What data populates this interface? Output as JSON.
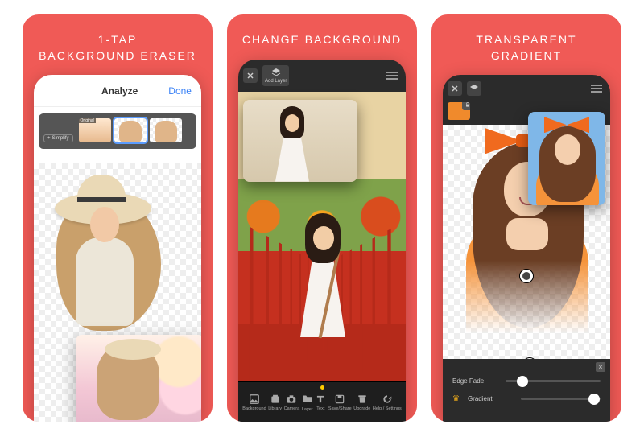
{
  "cards": [
    {
      "title": "1-TAP\nBACKGROUND ERASER"
    },
    {
      "title": "CHANGE BACKGROUND"
    },
    {
      "title": "TRANSPARENT\nGRADIENT"
    }
  ],
  "card1": {
    "header": {
      "title": "Analyze",
      "done": "Done"
    },
    "simplify_chip": "Simplify",
    "thumbs": {
      "original_label": "Original"
    }
  },
  "card2": {
    "top_buttons": {
      "close": "Close",
      "add_layer": "Add Layer"
    },
    "toolbar": [
      {
        "key": "background",
        "label": "Background"
      },
      {
        "key": "library",
        "label": "Library"
      },
      {
        "key": "camera",
        "label": "Camera"
      },
      {
        "key": "layer",
        "label": "Layer"
      },
      {
        "key": "text",
        "label": "Text"
      },
      {
        "key": "saveshare",
        "label": "Save/Share"
      },
      {
        "key": "upgrade",
        "label": "Upgrade"
      },
      {
        "key": "help",
        "label": "Help / Settings"
      }
    ]
  },
  "card3": {
    "top_buttons": {
      "close": "Close",
      "add_layer": "Add Layer"
    },
    "sliders": {
      "edge_fade": {
        "label": "Edge Fade",
        "value": 0.18
      },
      "gradient": {
        "label": "Gradient",
        "value": 0.92
      }
    }
  },
  "colors": {
    "brand": "#f05a56",
    "accent_orange": "#f5933a"
  }
}
